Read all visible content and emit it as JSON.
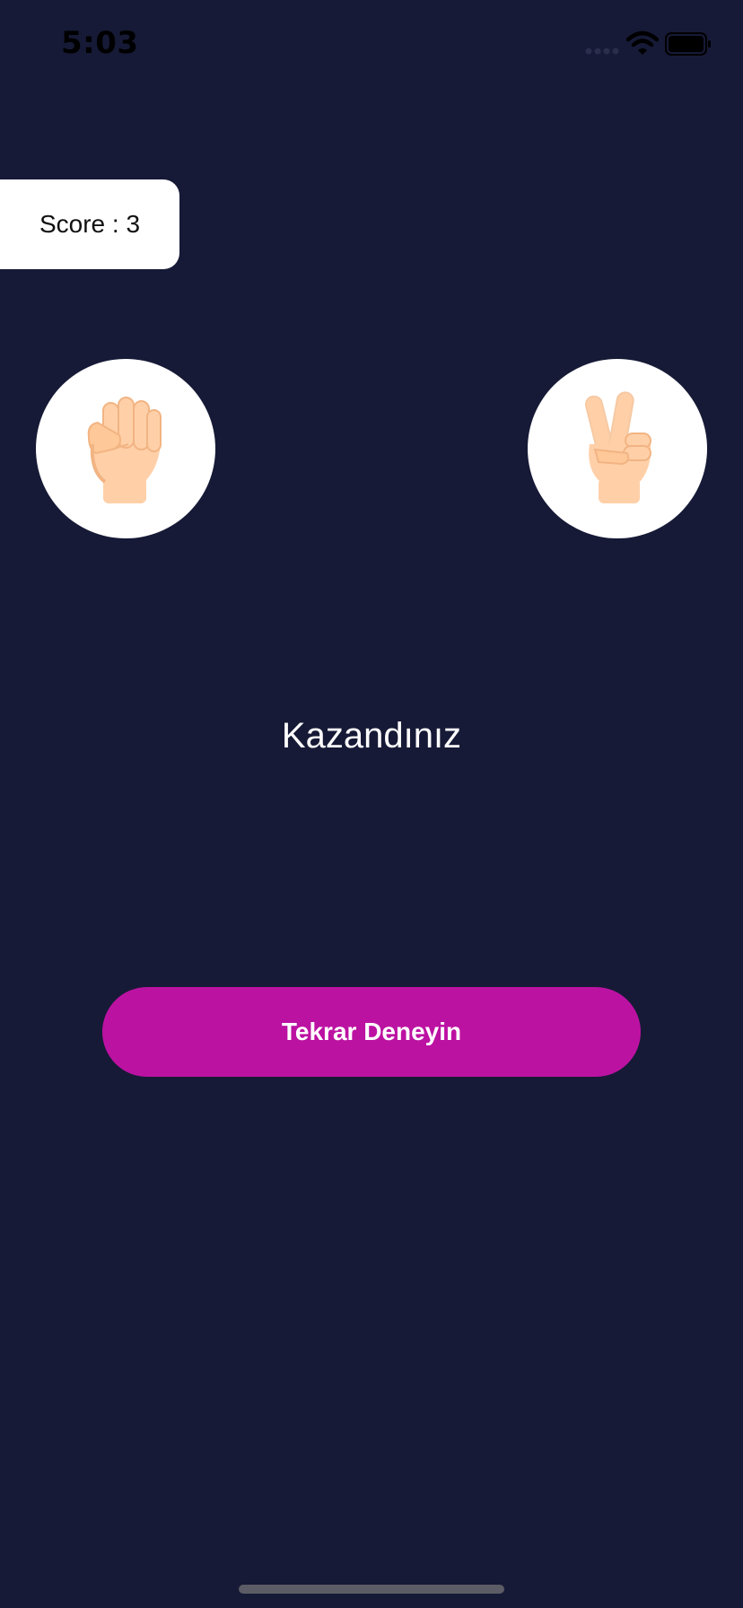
{
  "status_bar": {
    "time": "5:03",
    "icons": [
      "signal-icon",
      "wifi-icon",
      "battery-icon"
    ]
  },
  "score": {
    "label": "Score : 3",
    "value": 3
  },
  "game": {
    "player_choice": {
      "icon": "fist-rock-icon"
    },
    "opponent_choice": {
      "icon": "victory-scissors-icon"
    },
    "result": "Kazandınız"
  },
  "actions": {
    "retry_label": "Tekrar Deneyin"
  },
  "colors": {
    "background": "#161a36",
    "button": "#bc12a2",
    "card": "#ffffff",
    "skin": "#ffd0a8",
    "skin_shadow": "#f2b483"
  }
}
